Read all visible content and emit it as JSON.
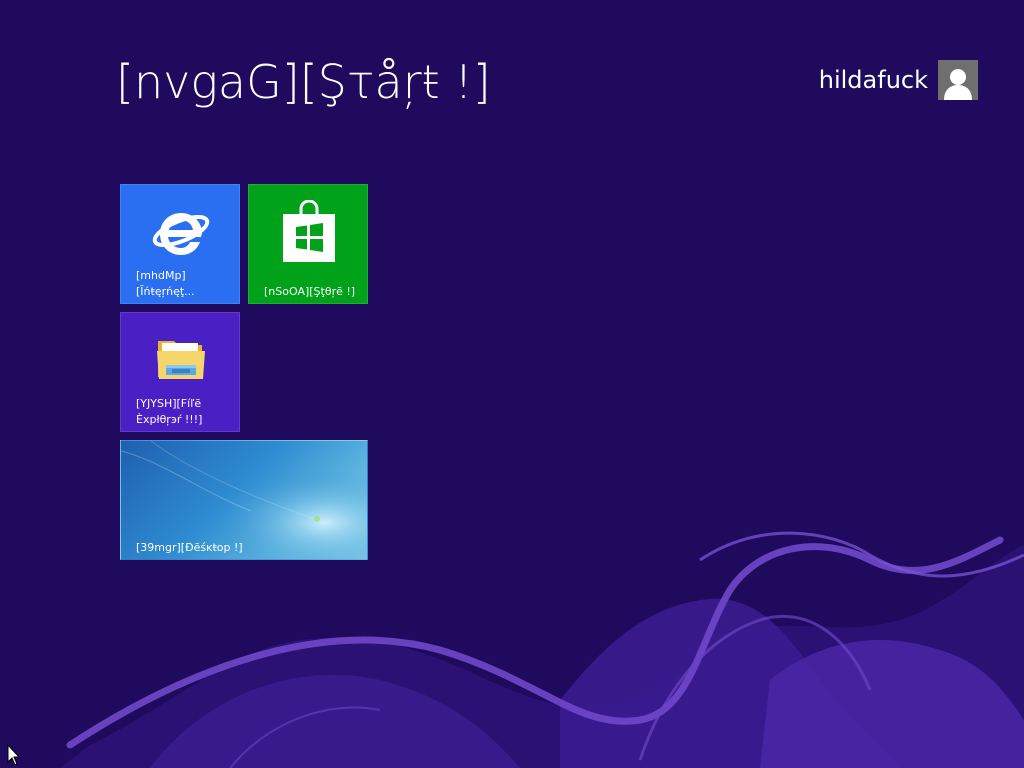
{
  "start": {
    "title": "[nvgaG][Şτåŗŧ !]"
  },
  "user": {
    "name": "hildafuck"
  },
  "tiles": [
    {
      "id": "ie",
      "label": "[mhdMp]\n[Ĭńŧęŗńęţ..."
    },
    {
      "id": "store",
      "label": "[nSoOA][Şţθŗē !]"
    },
    {
      "id": "explorer",
      "label": "[YJYSH][Fíľē\nÈxpłθŗэŕ !!!]"
    },
    {
      "id": "desktop",
      "label": "[39mgr][Ðēśĸŧop !]"
    }
  ],
  "colors": {
    "background": "#1f0a5e",
    "ie_tile": "#2a6ff2",
    "store_tile": "#00a21a",
    "explorer_tile": "#4a1fc4",
    "swirl": "#6f48c9"
  }
}
